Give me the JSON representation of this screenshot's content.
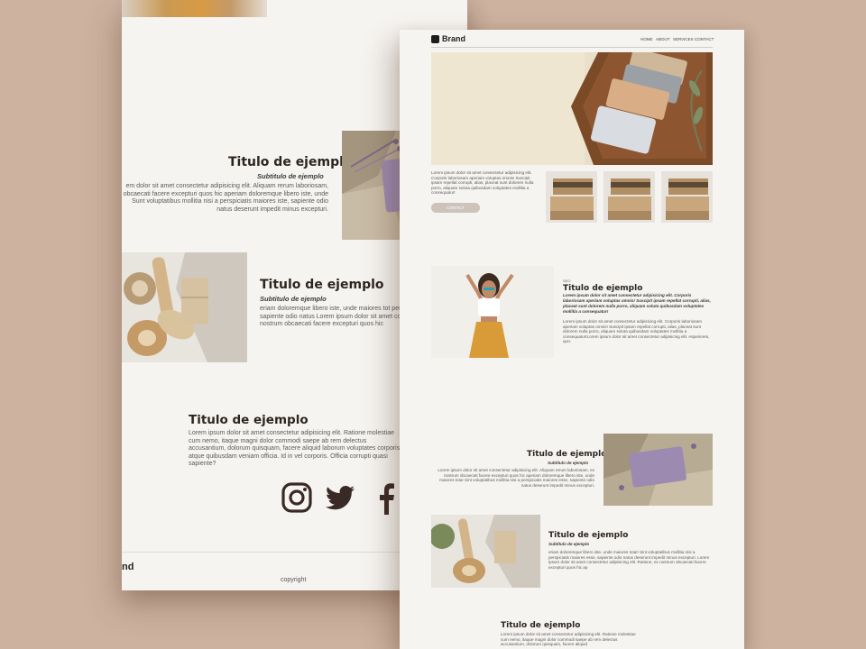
{
  "back_page": {
    "section1": {
      "title": "Titulo de ejemplo",
      "subtitle": "Subtitulo de ejemplo",
      "paragraph": "em dolor sit amet consectetur adipisicing elit. Aliquam rerum laboriosam, obcaecati facere excepturi quos hic aperiam doloremque libero iste, unde Sunt voluptatibus mollitia nisi a perspiciatis maiores iste, sapiente odio natus deserunt impedit minus excepturi."
    },
    "section2": {
      "title": "Titulo de ejemplo",
      "subtitle": "Subtitulo de ejemplo",
      "paragraph": "eriam doloremque libero iste, unde maiores tot perspiciatis maiores esse, sapiente odio natus Lorem ipsum dolor sit amet consectetur adipisici ex nostrum obcaecati facere excepturi quos hic"
    },
    "section3": {
      "title": "Titulo de ejemplo",
      "paragraph": "Lorem ipsum dolor sit amet consectetur adipisicing elit. Ratione molestiae cum nemo, itaque magni dolor commodi saepe ab rem delectus accusantium, dolorum quisquam, facere aliquid laborum voluptates corporis atque quibusdam veniam officia. Id in vel corporis. Officia corrupti quasi sapiente?"
    },
    "social": {
      "instagram": "instagram-icon",
      "twitter": "twitter-icon",
      "facebook": "facebook-icon"
    },
    "footer": {
      "brand": "nd",
      "copyright": "copyright"
    }
  },
  "front_page": {
    "header": {
      "brand": "Brand",
      "nav": [
        "HOME",
        "ABOUT",
        "SERVICES",
        "CONTACT"
      ]
    },
    "hero": {
      "paragraph": "Lorem ipsum dolor sit amet consectetur adipisicing elit. Corporis laboriosam aperiam voluptas omnis! Suscipit ipsam repellat corrupti, alias, placeat sunt dolorem nulla porro, aliquam soluta quibusdam voluptates mollitia a consequatur!",
      "button": "CONTACT"
    },
    "section1": {
      "eyebrow": "SEO",
      "title": "Titulo de ejemplo",
      "bold_paragraph": "Lorem ipsum dolor sit amet consectetur adipisicing elit. Corporis laboriosam aperiam voluptas omnis! Suscipit ipsam repellat corrupti, alias, placeat sunt dolorem nulla porro, aliquam soluta quibusdam voluptates mollitia a consequatur!",
      "paragraph": "Lorem ipsum dolor sit amet consectetur adipisicing elit. Corporis laboriosam aperiam voluptas omnis! Suscipit ipsam repellat corrupti, alias, placeat sunt dolorem nulla porro, aliquam soluta quibusdam voluptates mollitia a consequatur!Lorem ipsum dolor sit amet consectetur adipisicing elit. Asperiores, quo."
    },
    "section2": {
      "title": "Titulo de ejemplo",
      "subtitle": "Subtitulo de ejemplo",
      "paragraph": "Lorem ipsum dolor sit amet consectetur adipisicing elit. Aliquam rerum laboriosam, ex nostrum obcaecati facere excepturi quos hic aperiam doloremque libero iste, unde maiores tota! Sint voluptatibus mollitia nisi a perspiciatis maiores esse, sapiente odio natus deserunt impedit minus excepturi."
    },
    "section3": {
      "title": "Titulo de ejemplo",
      "subtitle": "Subtitulo de ejemplo",
      "paragraph": "eriam doloremque libero iste, unde maiores tota!! Sint voluptatibus mollitia nisi a perspiciatis maiores esse, sapiente odio natus deserunt impedit minus excepturi. Lorem ipsum dolor sit amet consectetur adipisicing elit. Ratione, ex nostrum obcaecati facere excepturi quos hic ap"
    },
    "section4": {
      "title": "Titulo de ejemplo",
      "paragraph": "Lorem ipsum dolor sit amet consectetur adipisicing elit. Ratione molestiae cum nemo, itaque magni dolor commodi saepe ab rem delectus accusantium, dolorum quisquam, facere aliquid"
    }
  },
  "colors": {
    "background": "#cdb2a0",
    "page": "#f6f4f1",
    "heading": "#2d2520",
    "button": "#ccc3bb"
  }
}
